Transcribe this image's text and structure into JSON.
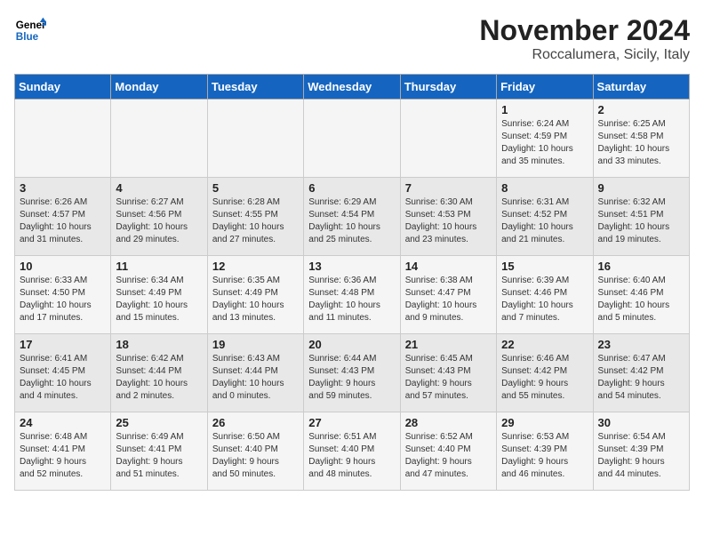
{
  "header": {
    "logo_line1": "General",
    "logo_line2": "Blue",
    "month": "November 2024",
    "location": "Roccalumera, Sicily, Italy"
  },
  "days_of_week": [
    "Sunday",
    "Monday",
    "Tuesday",
    "Wednesday",
    "Thursday",
    "Friday",
    "Saturday"
  ],
  "weeks": [
    [
      {
        "num": "",
        "info": ""
      },
      {
        "num": "",
        "info": ""
      },
      {
        "num": "",
        "info": ""
      },
      {
        "num": "",
        "info": ""
      },
      {
        "num": "",
        "info": ""
      },
      {
        "num": "1",
        "info": "Sunrise: 6:24 AM\nSunset: 4:59 PM\nDaylight: 10 hours\nand 35 minutes."
      },
      {
        "num": "2",
        "info": "Sunrise: 6:25 AM\nSunset: 4:58 PM\nDaylight: 10 hours\nand 33 minutes."
      }
    ],
    [
      {
        "num": "3",
        "info": "Sunrise: 6:26 AM\nSunset: 4:57 PM\nDaylight: 10 hours\nand 31 minutes."
      },
      {
        "num": "4",
        "info": "Sunrise: 6:27 AM\nSunset: 4:56 PM\nDaylight: 10 hours\nand 29 minutes."
      },
      {
        "num": "5",
        "info": "Sunrise: 6:28 AM\nSunset: 4:55 PM\nDaylight: 10 hours\nand 27 minutes."
      },
      {
        "num": "6",
        "info": "Sunrise: 6:29 AM\nSunset: 4:54 PM\nDaylight: 10 hours\nand 25 minutes."
      },
      {
        "num": "7",
        "info": "Sunrise: 6:30 AM\nSunset: 4:53 PM\nDaylight: 10 hours\nand 23 minutes."
      },
      {
        "num": "8",
        "info": "Sunrise: 6:31 AM\nSunset: 4:52 PM\nDaylight: 10 hours\nand 21 minutes."
      },
      {
        "num": "9",
        "info": "Sunrise: 6:32 AM\nSunset: 4:51 PM\nDaylight: 10 hours\nand 19 minutes."
      }
    ],
    [
      {
        "num": "10",
        "info": "Sunrise: 6:33 AM\nSunset: 4:50 PM\nDaylight: 10 hours\nand 17 minutes."
      },
      {
        "num": "11",
        "info": "Sunrise: 6:34 AM\nSunset: 4:49 PM\nDaylight: 10 hours\nand 15 minutes."
      },
      {
        "num": "12",
        "info": "Sunrise: 6:35 AM\nSunset: 4:49 PM\nDaylight: 10 hours\nand 13 minutes."
      },
      {
        "num": "13",
        "info": "Sunrise: 6:36 AM\nSunset: 4:48 PM\nDaylight: 10 hours\nand 11 minutes."
      },
      {
        "num": "14",
        "info": "Sunrise: 6:38 AM\nSunset: 4:47 PM\nDaylight: 10 hours\nand 9 minutes."
      },
      {
        "num": "15",
        "info": "Sunrise: 6:39 AM\nSunset: 4:46 PM\nDaylight: 10 hours\nand 7 minutes."
      },
      {
        "num": "16",
        "info": "Sunrise: 6:40 AM\nSunset: 4:46 PM\nDaylight: 10 hours\nand 5 minutes."
      }
    ],
    [
      {
        "num": "17",
        "info": "Sunrise: 6:41 AM\nSunset: 4:45 PM\nDaylight: 10 hours\nand 4 minutes."
      },
      {
        "num": "18",
        "info": "Sunrise: 6:42 AM\nSunset: 4:44 PM\nDaylight: 10 hours\nand 2 minutes."
      },
      {
        "num": "19",
        "info": "Sunrise: 6:43 AM\nSunset: 4:44 PM\nDaylight: 10 hours\nand 0 minutes."
      },
      {
        "num": "20",
        "info": "Sunrise: 6:44 AM\nSunset: 4:43 PM\nDaylight: 9 hours\nand 59 minutes."
      },
      {
        "num": "21",
        "info": "Sunrise: 6:45 AM\nSunset: 4:43 PM\nDaylight: 9 hours\nand 57 minutes."
      },
      {
        "num": "22",
        "info": "Sunrise: 6:46 AM\nSunset: 4:42 PM\nDaylight: 9 hours\nand 55 minutes."
      },
      {
        "num": "23",
        "info": "Sunrise: 6:47 AM\nSunset: 4:42 PM\nDaylight: 9 hours\nand 54 minutes."
      }
    ],
    [
      {
        "num": "24",
        "info": "Sunrise: 6:48 AM\nSunset: 4:41 PM\nDaylight: 9 hours\nand 52 minutes."
      },
      {
        "num": "25",
        "info": "Sunrise: 6:49 AM\nSunset: 4:41 PM\nDaylight: 9 hours\nand 51 minutes."
      },
      {
        "num": "26",
        "info": "Sunrise: 6:50 AM\nSunset: 4:40 PM\nDaylight: 9 hours\nand 50 minutes."
      },
      {
        "num": "27",
        "info": "Sunrise: 6:51 AM\nSunset: 4:40 PM\nDaylight: 9 hours\nand 48 minutes."
      },
      {
        "num": "28",
        "info": "Sunrise: 6:52 AM\nSunset: 4:40 PM\nDaylight: 9 hours\nand 47 minutes."
      },
      {
        "num": "29",
        "info": "Sunrise: 6:53 AM\nSunset: 4:39 PM\nDaylight: 9 hours\nand 46 minutes."
      },
      {
        "num": "30",
        "info": "Sunrise: 6:54 AM\nSunset: 4:39 PM\nDaylight: 9 hours\nand 44 minutes."
      }
    ]
  ]
}
